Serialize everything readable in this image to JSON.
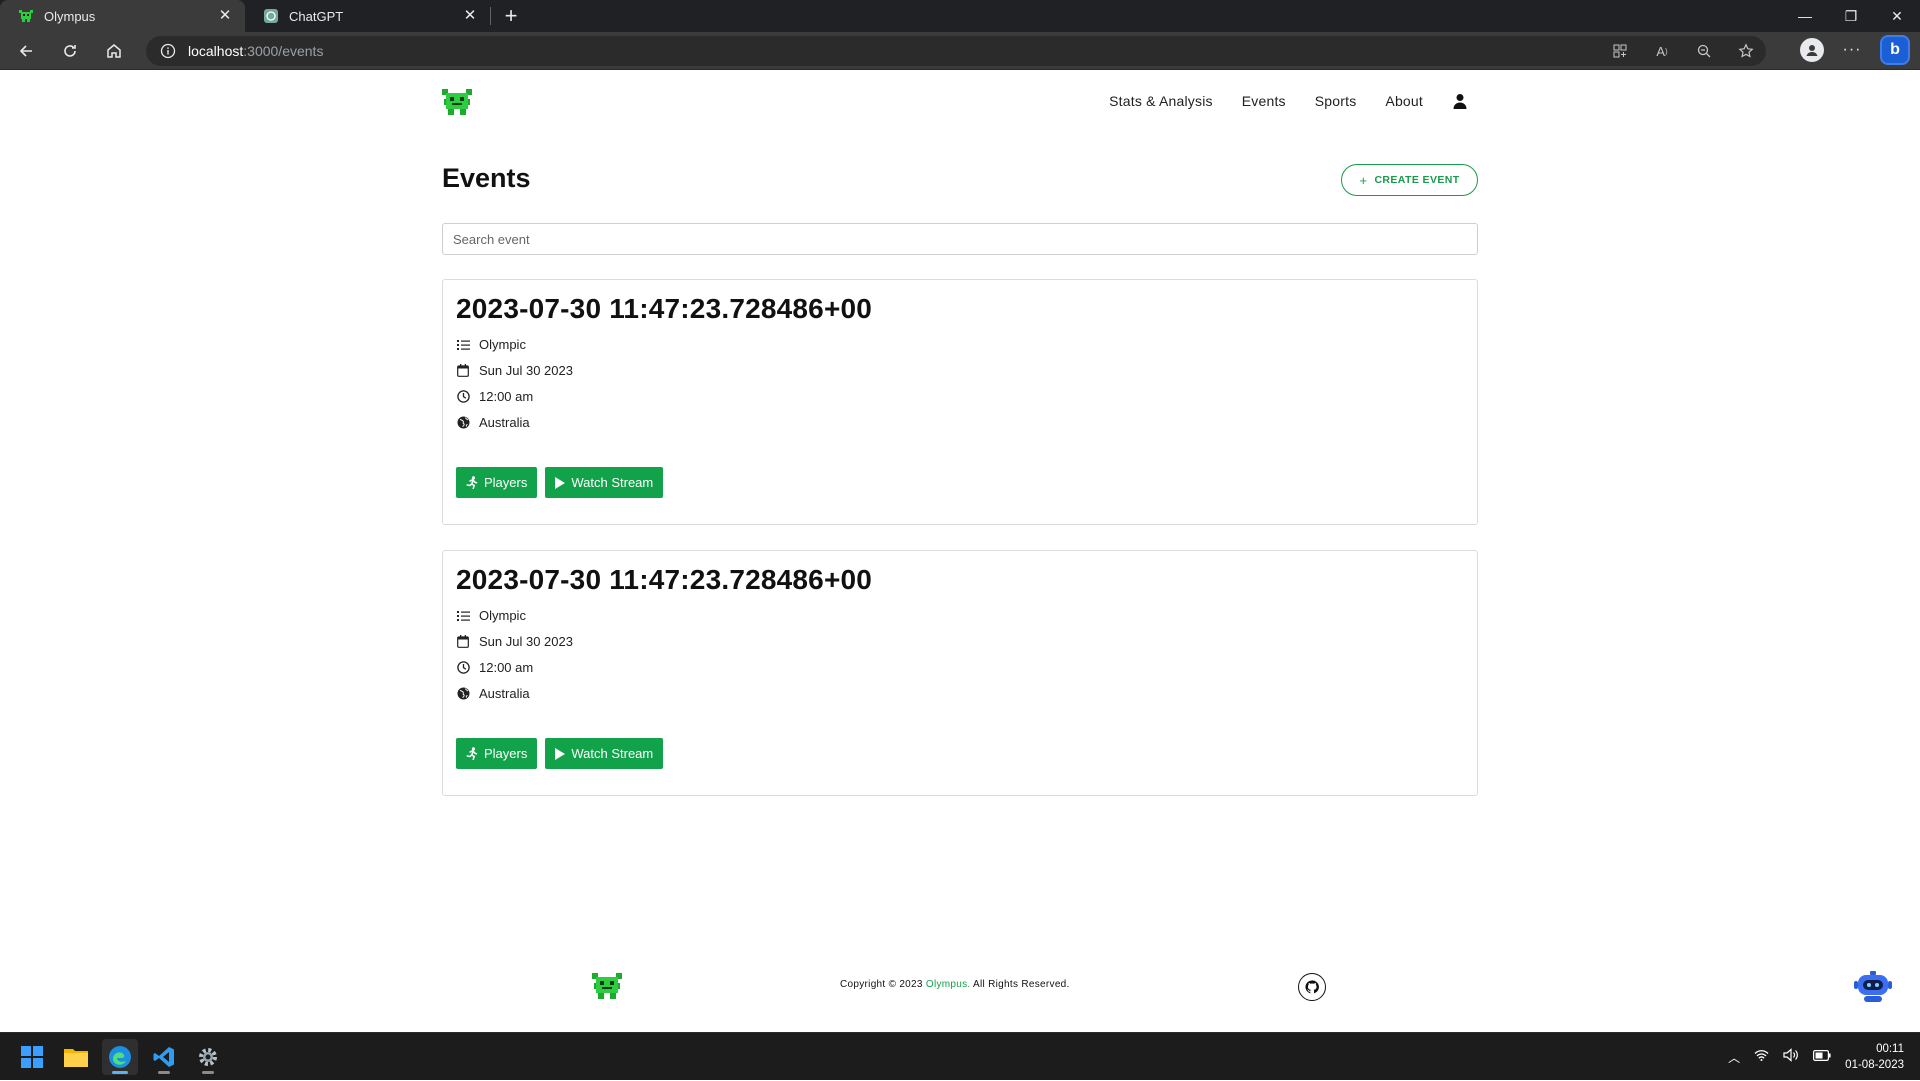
{
  "browser": {
    "tabs": [
      {
        "title": "Olympus",
        "active": true,
        "icon": "olympus-favicon"
      },
      {
        "title": "ChatGPT",
        "active": false,
        "icon": "chatgpt-favicon"
      }
    ],
    "address": {
      "host": "localhost",
      "path": ":3000/events"
    }
  },
  "site": {
    "nav": [
      "Stats & Analysis",
      "Events",
      "Sports",
      "About"
    ],
    "page_title": "Events",
    "create_button": "CREATE EVENT",
    "search_placeholder": "Search event"
  },
  "events": [
    {
      "title": "2023-07-30 11:47:23.728486+00",
      "category": "Olympic",
      "date": "Sun Jul 30 2023",
      "time": "12:00 am",
      "location": "Australia",
      "players_label": "Players",
      "stream_label": "Watch Stream"
    },
    {
      "title": "2023-07-30 11:47:23.728486+00",
      "category": "Olympic",
      "date": "Sun Jul 30 2023",
      "time": "12:00 am",
      "location": "Australia",
      "players_label": "Players",
      "stream_label": "Watch Stream"
    }
  ],
  "footer": {
    "copyright_prefix": "Copyright © 2023 ",
    "brand": "Olympus.",
    "copyright_suffix": " All Rights Reserved."
  },
  "taskbar": {
    "time": "00:11",
    "date": "01-08-2023"
  },
  "colors": {
    "accent_green": "#12a24a",
    "browser_dark": "#202124"
  }
}
